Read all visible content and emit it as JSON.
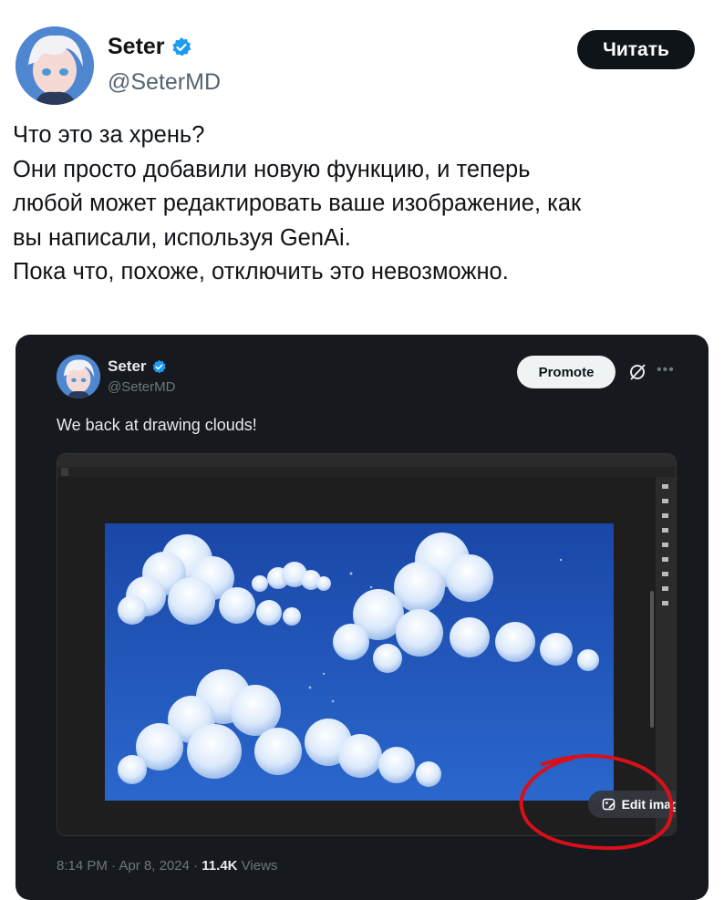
{
  "author": {
    "name": "Seter",
    "handle": "@SeterMD",
    "verified": true
  },
  "read_button": {
    "label": "Читать"
  },
  "tweet_lines": [
    "Что это за хрень?",
    "Они просто добавили новую функцию, и теперь",
    "любой может редактировать ваше изображение, как",
    "вы написали, используя GenAi.",
    "Пока что, похоже, отключить это невозможно."
  ],
  "embedded": {
    "author": {
      "name": "Seter",
      "handle": "@SeterMD"
    },
    "promote_label": "Promote",
    "text": "We back at drawing clouds!",
    "edit_image_label": "Edit image",
    "photo_description_icons": [
      "grok-icon",
      "more-icon",
      "edit-image-icon"
    ],
    "meta": {
      "time": "8:14 PM",
      "date": "Apr 8, 2024",
      "views_count": "11.4K",
      "views_label": "Views"
    }
  },
  "colors": {
    "verified_blue": "#1d9bf0",
    "sky": "#1a4fb4",
    "highlight_red": "#d8101a"
  }
}
